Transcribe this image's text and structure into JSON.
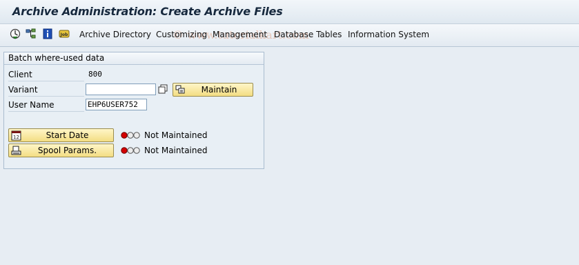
{
  "window": {
    "title": "Archive Administration: Create Archive Files"
  },
  "toolbar": {
    "icons": [
      "execute-icon",
      "hierarchy-icon",
      "info-icon",
      "job-icon"
    ],
    "job_icon_text": "Job",
    "menu": [
      "Archive Directory",
      "Customizing",
      "Management",
      "Database Tables",
      "Information System"
    ],
    "watermark": "© www.tutorialkart.com"
  },
  "group": {
    "title": "Batch where-used data",
    "client_label": "Client",
    "client_value": "800",
    "variant_label": "Variant",
    "variant_value": "",
    "maintain_label": "Maintain",
    "username_label": "User Name",
    "username_value": "EHP6USER752",
    "start_date_label": "Start Date",
    "start_date_status": "Not Maintained",
    "spool_label": "Spool Params.",
    "spool_status": "Not Maintained",
    "start_date_icon_text": "12"
  },
  "colors": {
    "accent_button": "#f3dd83",
    "status_red": "#d40000"
  }
}
